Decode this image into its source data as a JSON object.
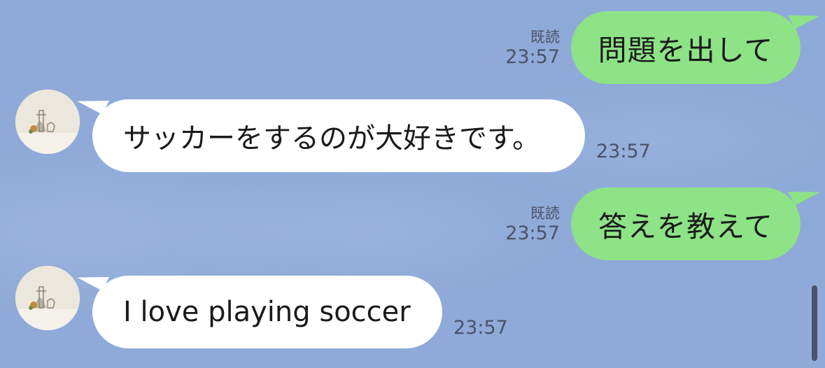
{
  "messages": [
    {
      "direction": "outgoing",
      "text": "問題を出して",
      "read_label": "既読",
      "time": "23:57"
    },
    {
      "direction": "incoming",
      "text": "サッカーをするのが大好きです。",
      "time": "23:57"
    },
    {
      "direction": "outgoing",
      "text": "答えを教えて",
      "read_label": "既読",
      "time": "23:57"
    },
    {
      "direction": "incoming",
      "text": "I love playing soccer",
      "time": "23:57"
    }
  ],
  "colors": {
    "background": "#8faad8",
    "outgoing_bubble": "#8de385",
    "incoming_bubble": "#ffffff",
    "meta_text": "#4a5266"
  },
  "icons": {
    "avatar": "avatar-illustration"
  }
}
